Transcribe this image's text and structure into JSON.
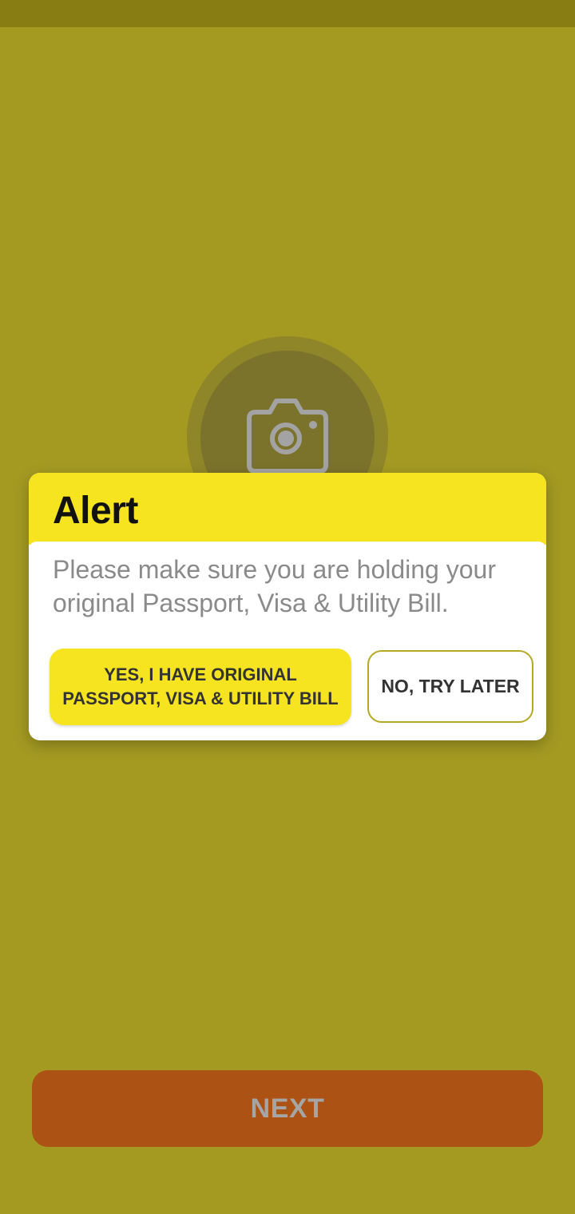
{
  "dialog": {
    "title": "Alert",
    "message": "Please make sure you are holding your original Passport, Visa & Utility Bill.",
    "confirm_label": "YES, I HAVE ORIGINAL PASSPORT, VISA & UTILITY BILL",
    "cancel_label": "NO, TRY LATER"
  },
  "footer": {
    "next_label": "NEXT"
  },
  "icons": {
    "camera": "camera-icon"
  },
  "colors": {
    "background_dimmed": "#a49a22",
    "accent_yellow": "#f5e41f",
    "next_button": "#ac5214"
  }
}
